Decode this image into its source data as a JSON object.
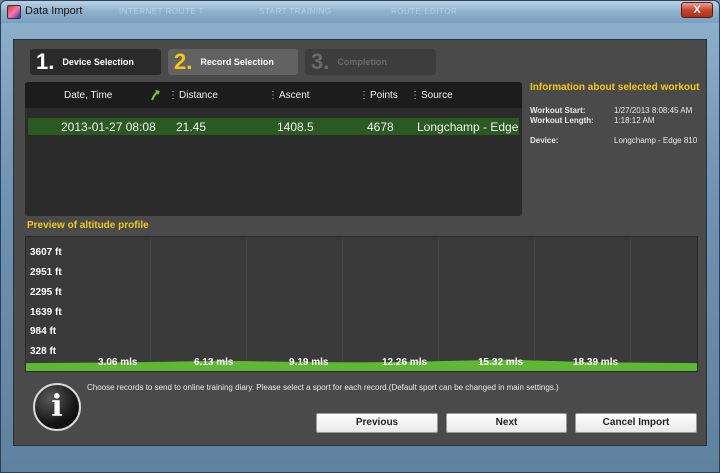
{
  "window": {
    "title": "Data Import",
    "close_label": "X"
  },
  "background_ghost": [
    "INTERNET ROUTE T",
    "START TRAINING",
    "ROUTE EDITOR"
  ],
  "steps": [
    {
      "number": "1.",
      "label": "Device Selection",
      "state": "done"
    },
    {
      "number": "2.",
      "label": "Record Selection",
      "state": "active"
    },
    {
      "number": "3.",
      "label": "Completion",
      "state": "disabled"
    }
  ],
  "table": {
    "columns": [
      "Date, Time",
      "Distance",
      "Ascent",
      "Points",
      "Source"
    ],
    "rows": [
      {
        "date": "2013-01-27 08:08",
        "distance": "21.45",
        "ascent": "1408.5",
        "points": "4678",
        "source": "Longchamp - Edge"
      }
    ]
  },
  "info": {
    "title": "Information about selected workout",
    "start_label": "Workout Start:",
    "start_value": "1/27/2013 8:08:45 AM",
    "length_label": "Workout Length:",
    "length_value": "1:18:12 AM",
    "device_label": "Device:",
    "device_value": "Longchamp - Edge 810"
  },
  "preview": {
    "title": "Preview of altitude profile"
  },
  "chart_data": {
    "type": "area",
    "y_ticks": [
      "3607 ft",
      "2951 ft",
      "2295 ft",
      "1639 ft",
      "984 ft",
      "328 ft"
    ],
    "x_ticks": [
      "3.06 mls",
      "6.13 mls",
      "9.19 mls",
      "12.26 mls",
      "15.32 mls",
      "18.39 mls"
    ],
    "x": [
      0,
      1.5,
      3.06,
      4.5,
      6.13,
      7.5,
      9.19,
      10.7,
      12.26,
      13.8,
      15.32,
      16.8,
      18.39,
      20,
      21.45
    ],
    "y": [
      230,
      240,
      250,
      270,
      300,
      280,
      260,
      250,
      270,
      300,
      330,
      290,
      250,
      240,
      230
    ],
    "xlim": [
      0,
      21.45
    ],
    "ylim": [
      0,
      3900
    ],
    "color": "#5fb833"
  },
  "message": "Choose records to send to online training diary. Please select a sport for each record.(Default sport can be changed in main settings.)",
  "buttons": {
    "previous": "Previous",
    "next": "Next",
    "cancel": "Cancel Import"
  }
}
